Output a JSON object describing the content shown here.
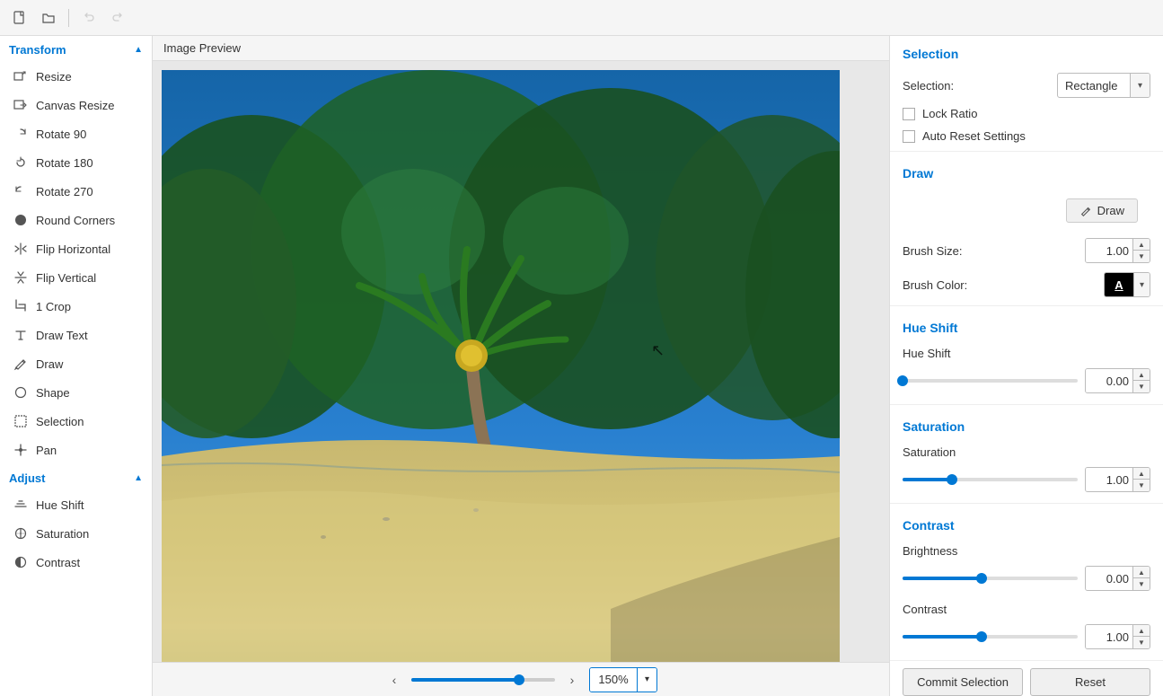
{
  "toolbar": {
    "new_label": "New",
    "open_label": "Open",
    "undo_label": "Undo",
    "redo_label": "Redo"
  },
  "canvas": {
    "header_label": "Image Preview",
    "zoom_value": "150%",
    "cursor_symbol": "⬆"
  },
  "sidebar": {
    "transform_label": "Transform",
    "adjust_label": "Adjust",
    "items_transform": [
      {
        "id": "resize",
        "label": "Resize"
      },
      {
        "id": "canvas-resize",
        "label": "Canvas Resize"
      },
      {
        "id": "rotate-90",
        "label": "Rotate 90"
      },
      {
        "id": "rotate-180",
        "label": "Rotate 180"
      },
      {
        "id": "rotate-270",
        "label": "Rotate 270"
      },
      {
        "id": "round-corners",
        "label": "Round Corners"
      },
      {
        "id": "flip-horizontal",
        "label": "Flip Horizontal"
      },
      {
        "id": "flip-vertical",
        "label": "Flip Vertical"
      },
      {
        "id": "crop",
        "label": "Crop"
      },
      {
        "id": "draw-text",
        "label": "Draw Text"
      },
      {
        "id": "draw",
        "label": "Draw"
      },
      {
        "id": "shape",
        "label": "Shape"
      },
      {
        "id": "selection",
        "label": "Selection"
      },
      {
        "id": "pan",
        "label": "Pan"
      }
    ],
    "items_adjust": [
      {
        "id": "hue-shift",
        "label": "Hue Shift"
      },
      {
        "id": "saturation",
        "label": "Saturation"
      },
      {
        "id": "contrast",
        "label": "Contrast"
      }
    ]
  },
  "right_panel": {
    "selection_title": "Selection",
    "selection_label": "Selection:",
    "selection_value": "Rectangle",
    "lock_ratio_label": "Lock Ratio",
    "auto_reset_label": "Auto Reset Settings",
    "draw_section_title": "Draw",
    "draw_button_label": "Draw",
    "brush_size_label": "Brush Size:",
    "brush_size_value": "1.00",
    "brush_color_label": "Brush Color:",
    "hue_shift_title": "Hue Shift",
    "hue_shift_label": "Hue Shift",
    "hue_shift_value": "0.00",
    "hue_shift_pct": 0,
    "saturation_title": "Saturation",
    "saturation_label": "Saturation",
    "saturation_value": "1.00",
    "saturation_pct": 28,
    "contrast_title": "Contrast",
    "brightness_label": "Brightness",
    "brightness_value": "0.00",
    "brightness_pct": 45,
    "contrast_label": "Contrast",
    "contrast_value": "1.00",
    "contrast_pct": 45,
    "commit_label": "Commit Selection",
    "reset_label": "Reset"
  }
}
